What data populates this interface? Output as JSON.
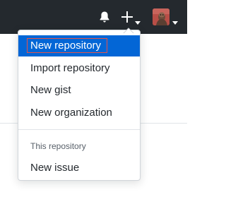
{
  "header": {
    "notifications_icon": "bell-icon",
    "create_icon": "plus-icon",
    "user_avatar": "avatar"
  },
  "colors": {
    "header_bg": "#24292e",
    "selected_bg": "#0366d6",
    "highlight_border": "#e5534b"
  },
  "dropdown": {
    "items": [
      {
        "label": "New repository",
        "selected": true
      },
      {
        "label": "Import repository"
      },
      {
        "label": "New gist"
      },
      {
        "label": "New organization"
      }
    ],
    "section_header": "This repository",
    "section_items": [
      {
        "label": "New issue"
      }
    ]
  }
}
